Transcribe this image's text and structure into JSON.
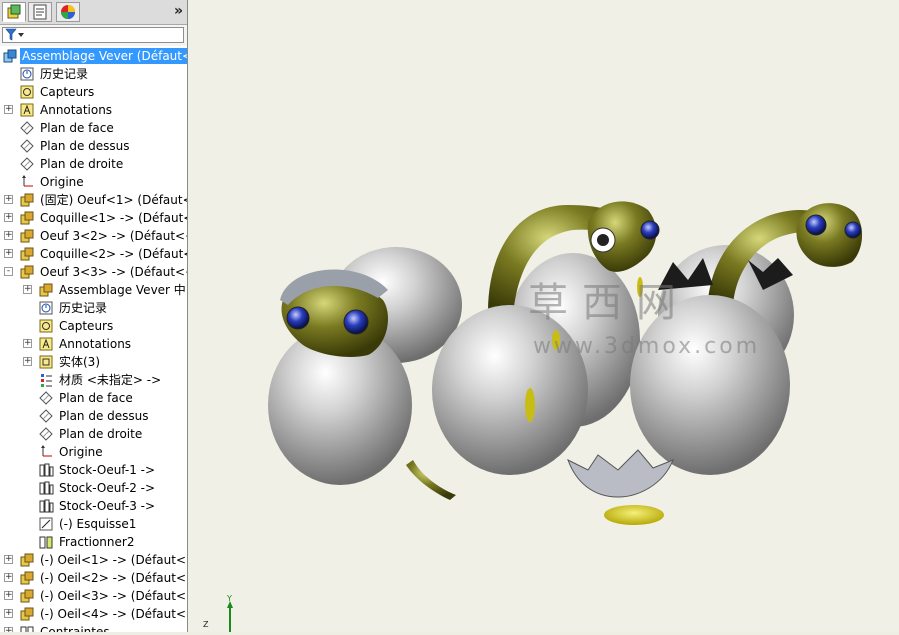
{
  "tree": {
    "root": "Assemblage Vever  (Défaut<",
    "items": [
      {
        "label": "历史记录",
        "icon": "history-icon",
        "indent": 0,
        "expand": ""
      },
      {
        "label": "Capteurs",
        "icon": "sensor-icon",
        "indent": 0,
        "expand": ""
      },
      {
        "label": "Annotations",
        "icon": "annotation-icon",
        "indent": 0,
        "expand": "+"
      },
      {
        "label": "Plan de face",
        "icon": "plane-icon",
        "indent": 0,
        "expand": ""
      },
      {
        "label": "Plan de dessus",
        "icon": "plane-icon",
        "indent": 0,
        "expand": ""
      },
      {
        "label": "Plan de droite",
        "icon": "plane-icon",
        "indent": 0,
        "expand": ""
      },
      {
        "label": "Origine",
        "icon": "origin-icon",
        "indent": 0,
        "expand": ""
      },
      {
        "label": "(固定) Oeuf<1> (Défaut<",
        "icon": "part-icon",
        "indent": 0,
        "expand": "+"
      },
      {
        "label": "Coquille<1> -> (Défaut<",
        "icon": "part-icon",
        "indent": 0,
        "expand": "+"
      },
      {
        "label": "Oeuf 3<2> -> (Défaut<<",
        "icon": "part-icon",
        "indent": 0,
        "expand": "+"
      },
      {
        "label": "Coquille<2> -> (Défaut<",
        "icon": "part-icon",
        "indent": 0,
        "expand": "+"
      },
      {
        "label": "Oeuf 3<3> -> (Défaut<<",
        "icon": "part-icon",
        "indent": 0,
        "expand": "-"
      },
      {
        "label": "Assemblage Vever 中",
        "icon": "part-icon",
        "indent": 1,
        "expand": "+"
      },
      {
        "label": "历史记录",
        "icon": "history-icon",
        "indent": 1,
        "expand": ""
      },
      {
        "label": "Capteurs",
        "icon": "sensor-icon",
        "indent": 1,
        "expand": ""
      },
      {
        "label": "Annotations",
        "icon": "annotation-icon",
        "indent": 1,
        "expand": "+"
      },
      {
        "label": "实体(3)",
        "icon": "solid-bodies-icon",
        "indent": 1,
        "expand": "+"
      },
      {
        "label": "材质 <未指定> ->",
        "icon": "material-icon",
        "indent": 1,
        "expand": ""
      },
      {
        "label": "Plan de face",
        "icon": "plane-icon",
        "indent": 1,
        "expand": ""
      },
      {
        "label": "Plan de dessus",
        "icon": "plane-icon",
        "indent": 1,
        "expand": ""
      },
      {
        "label": "Plan de droite",
        "icon": "plane-icon",
        "indent": 1,
        "expand": ""
      },
      {
        "label": "Origine",
        "icon": "origin-icon",
        "indent": 1,
        "expand": ""
      },
      {
        "label": "Stock-Oeuf-1 ->",
        "icon": "stock-icon",
        "indent": 1,
        "expand": ""
      },
      {
        "label": "Stock-Oeuf-2 ->",
        "icon": "stock-icon",
        "indent": 1,
        "expand": ""
      },
      {
        "label": "Stock-Oeuf-3 ->",
        "icon": "stock-icon",
        "indent": 1,
        "expand": ""
      },
      {
        "label": "(-) Esquisse1",
        "icon": "sketch-icon",
        "indent": 1,
        "expand": ""
      },
      {
        "label": "Fractionner2",
        "icon": "split-icon",
        "indent": 1,
        "expand": ""
      },
      {
        "label": "(-) Oeil<1> -> (Défaut<<",
        "icon": "part-icon",
        "indent": 0,
        "expand": "+"
      },
      {
        "label": "(-) Oeil<2> -> (Défaut<<",
        "icon": "part-icon",
        "indent": 0,
        "expand": "+"
      },
      {
        "label": "(-) Oeil<3> -> (Défaut<<",
        "icon": "part-icon",
        "indent": 0,
        "expand": "+"
      },
      {
        "label": "(-) Oeil<4> -> (Défaut<<",
        "icon": "part-icon",
        "indent": 0,
        "expand": "+"
      },
      {
        "label": "Contraintes",
        "icon": "mates-icon",
        "indent": 0,
        "expand": "+"
      }
    ]
  },
  "tabs": [
    {
      "name": "feature-manager-tab",
      "icon": "feature-tree-icon"
    },
    {
      "name": "property-manager-tab",
      "icon": "property-icon"
    },
    {
      "name": "appearance-tab",
      "icon": "appearance-icon"
    }
  ],
  "more_label": "»",
  "watermark": {
    "chars": "草西网",
    "url": "www.3dmox.com"
  },
  "triad": {
    "x": "Z",
    "y": "Y"
  },
  "colors": {
    "selection": "#3399ff",
    "egg": "#c8c8c8",
    "dino": "#6b6b1a",
    "eye": "#2a3dc0",
    "background": "#f0f0e6"
  }
}
